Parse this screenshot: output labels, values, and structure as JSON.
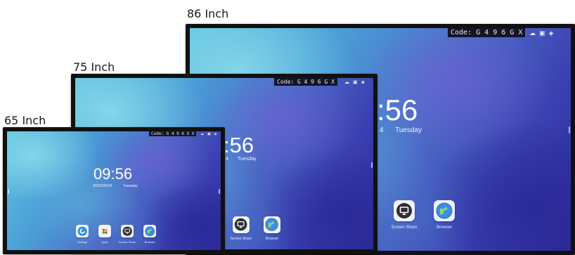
{
  "sizes": {
    "s86": "86 Inch",
    "s75": "75 Inch",
    "s65": "65 Inch"
  },
  "screens": {
    "s86": {
      "code": "Code: G 4 9 6 G X",
      "time": ":56",
      "weekday": "Tuesday",
      "date_fragment": "4",
      "apps": [
        "Screen Share",
        "Browser"
      ],
      "status_icons": [
        "cloud-icon",
        "image-icon",
        "wifi-icon"
      ]
    },
    "s75": {
      "code": "Code: G 4 9 6 G X",
      "time": ":56",
      "weekday": "Tuesday",
      "date_fragment": "4",
      "apps": [
        "Screen Share",
        "Browser"
      ],
      "status_icons": [
        "cloud-icon",
        "image-icon",
        "wifi-icon"
      ]
    },
    "s65": {
      "code": "Code: G 4 9 6 G X",
      "time": "09:56",
      "date": "2023/05/24",
      "weekday": "Tuesday",
      "apps": [
        "Settings",
        "Apps",
        "Screen Share",
        "Browser"
      ],
      "status_icons": [
        "cloud-icon",
        "image-icon",
        "wifi-icon"
      ]
    }
  },
  "colors": {
    "bezel": "#111111",
    "code_bg": "#15152a",
    "wallpaper_light": "#5fc3e0",
    "wallpaper_dark": "#2c2a96"
  }
}
